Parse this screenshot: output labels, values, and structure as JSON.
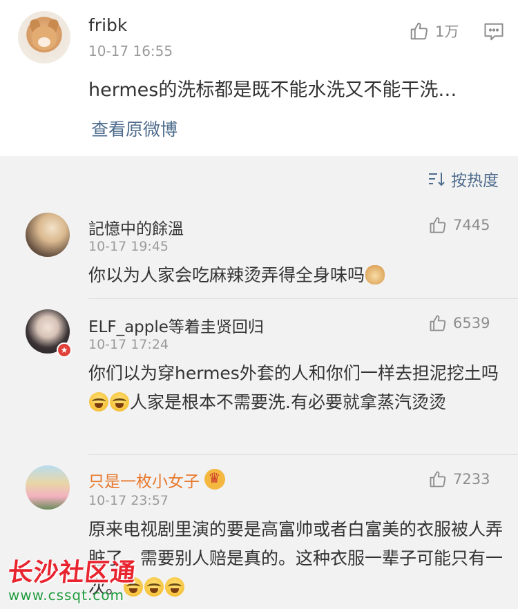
{
  "post": {
    "username": "fribk",
    "time": "10-17 16:55",
    "likes": "1万",
    "text": "hermes的洗标都是既不能水洗又不能干洗…",
    "view_original": "查看原微博",
    "avatar_icon": "shiba-dog-avatar"
  },
  "sort": {
    "label": "按热度",
    "icon": "sort-icon"
  },
  "comments": [
    {
      "username": "記憶中的餘溫",
      "time": "10-17 19:45",
      "likes": "7445",
      "text": "你以为人家会吃麻辣烫弄得全身味吗",
      "emoji": "doge-emoji"
    },
    {
      "username": "ELF_apple等着圭贤回归",
      "time": "10-17 17:24",
      "likes": "6539",
      "text_part1": "你们以为穿hermes外套的人和你们一样去担泥挖土吗",
      "text_part2": "人家是根本不需要洗.有必要就拿蒸汽烫烫",
      "emoji": "cry-laugh-emoji",
      "badge": "verified-badge"
    },
    {
      "username": "只是一枚小女子",
      "time": "10-17 23:57",
      "likes": "7233",
      "text": "原来电视剧里演的要是高富帅或者白富美的衣服被人弄脏了，需要别人赔是真的。这种衣服一辈子可能只有一次。",
      "emoji": "cry-laugh-emoji",
      "vip_icon": "crown-icon",
      "name_color": "#e8792d"
    }
  ],
  "watermark": {
    "title": "长沙社区通",
    "url": "www.cssqt.com"
  },
  "colors": {
    "link": "#4e6c8d",
    "time": "#9a9a9a",
    "vip_name": "#e8792d",
    "watermark_red": "#e8242f",
    "watermark_green": "#1f9a3c"
  }
}
